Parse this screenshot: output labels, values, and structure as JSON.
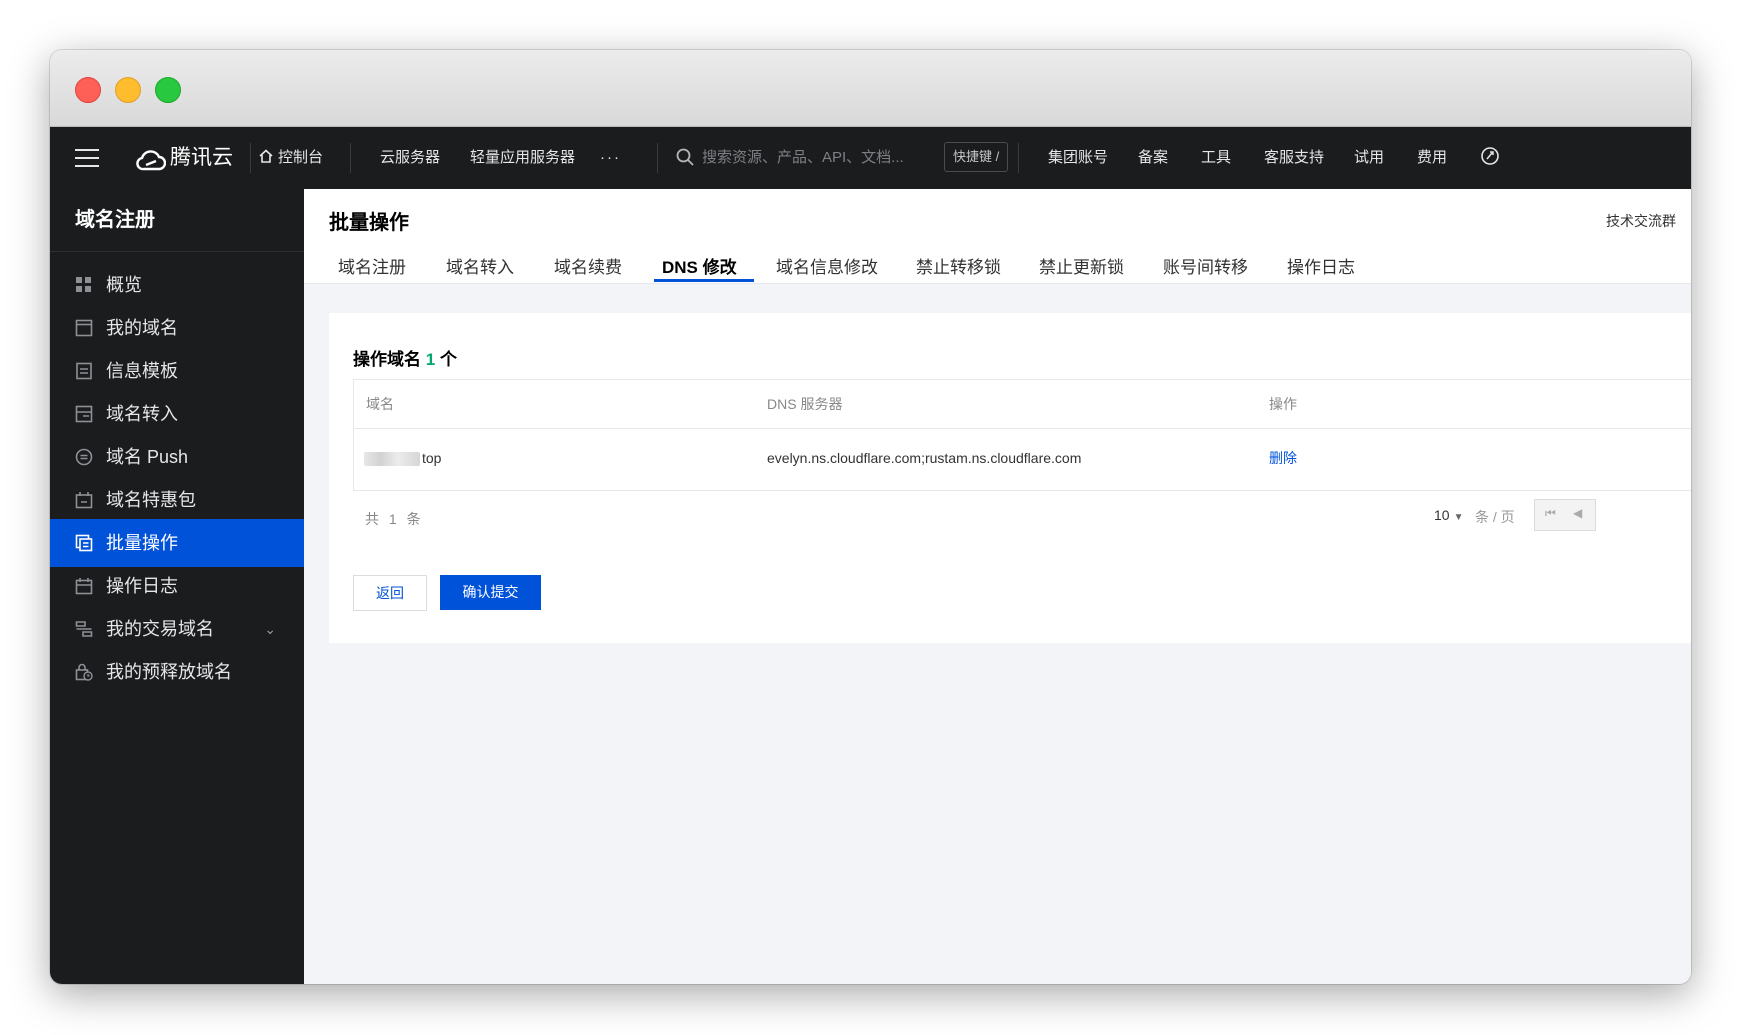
{
  "topnav": {
    "logo": "腾讯云",
    "console": "控制台",
    "links": [
      "云服务器",
      "轻量应用服务器"
    ],
    "more": "···",
    "search_placeholder": "搜索资源、产品、API、文档...",
    "shortcut": "快捷键 /",
    "right_links": [
      "集团账号",
      "备案",
      "工具",
      "客服支持",
      "试用",
      "费用"
    ]
  },
  "sidebar": {
    "title": "域名注册",
    "items": [
      {
        "label": "概览",
        "icon": "dashboard-grid-icon"
      },
      {
        "label": "我的域名",
        "icon": "window-icon"
      },
      {
        "label": "信息模板",
        "icon": "document-icon"
      },
      {
        "label": "域名转入",
        "icon": "transfer-icon"
      },
      {
        "label": "域名 Push",
        "icon": "push-icon"
      },
      {
        "label": "域名特惠包",
        "icon": "gift-icon"
      },
      {
        "label": "批量操作",
        "icon": "batch-icon",
        "active": true
      },
      {
        "label": "操作日志",
        "icon": "calendar-icon"
      },
      {
        "label": "我的交易域名",
        "icon": "trade-icon",
        "expandable": true
      },
      {
        "label": "我的预释放域名",
        "icon": "lock-clock-icon"
      }
    ]
  },
  "page": {
    "title": "批量操作",
    "tech_link": "技术交流群",
    "tabs": [
      "域名注册",
      "域名转入",
      "域名续费",
      "DNS 修改",
      "域名信息修改",
      "禁止转移锁",
      "禁止更新锁",
      "账号间转移",
      "操作日志"
    ],
    "active_tab": "DNS 修改"
  },
  "card": {
    "title_prefix": "操作域名",
    "count": "1",
    "title_suffix": "个",
    "columns": [
      "域名",
      "DNS 服务器",
      "操作"
    ],
    "rows": [
      {
        "domain_suffix": "top",
        "dns": "evelyn.ns.cloudflare.com;rustam.ns.cloudflare.com",
        "action": "删除"
      }
    ],
    "total": "共 1 条",
    "page_size": "10",
    "per_page": "条 / 页",
    "back_label": "返回",
    "submit_label": "确认提交"
  },
  "colors": {
    "brand_blue": "#0052d9",
    "count_green": "#00a870",
    "nav_bg": "#1b1c1e"
  }
}
